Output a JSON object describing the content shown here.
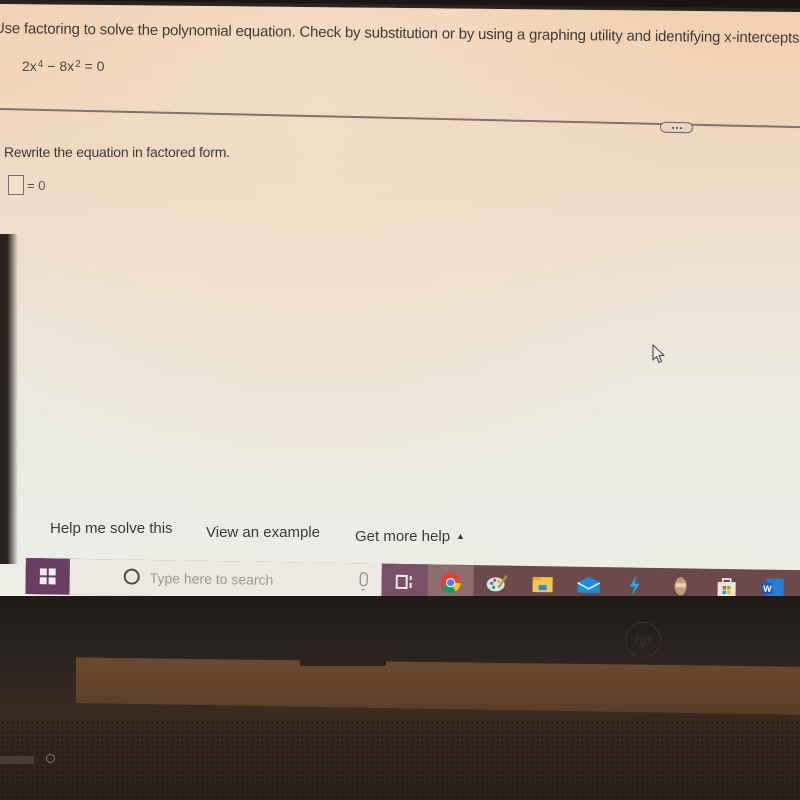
{
  "problem": {
    "instruction": "Use factoring to solve the polynomial equation. Check by substitution or by using a graphing utility and identifying x-intercepts.",
    "equation": {
      "term1_coef": "2x",
      "term1_exp": "4",
      "operator": " − 8x",
      "term2_exp": "2",
      "rhs": " = 0"
    },
    "more_button_icon": "ellipsis-icon"
  },
  "answer": {
    "prompt": "Rewrite the equation in factored form.",
    "input_value": "",
    "rhs": "= 0"
  },
  "help": {
    "help_me_solve": "Help me solve this",
    "view_example": "View an example",
    "get_more_help": "Get more help",
    "caret": "▲"
  },
  "taskbar": {
    "search_placeholder": "Type here to search",
    "icons": [
      {
        "name": "windows-start-icon"
      },
      {
        "name": "cortana-icon"
      },
      {
        "name": "microphone-icon"
      },
      {
        "name": "task-view-icon"
      },
      {
        "name": "chrome-icon",
        "active": true
      },
      {
        "name": "paint-icon"
      },
      {
        "name": "file-explorer-icon"
      },
      {
        "name": "mail-icon"
      },
      {
        "name": "lightning-app-icon"
      },
      {
        "name": "game-app-icon"
      },
      {
        "name": "microsoft-store-icon"
      },
      {
        "name": "word-icon"
      }
    ],
    "accent_color": "#6a3e63"
  },
  "hardware": {
    "logo_text": "hp"
  }
}
